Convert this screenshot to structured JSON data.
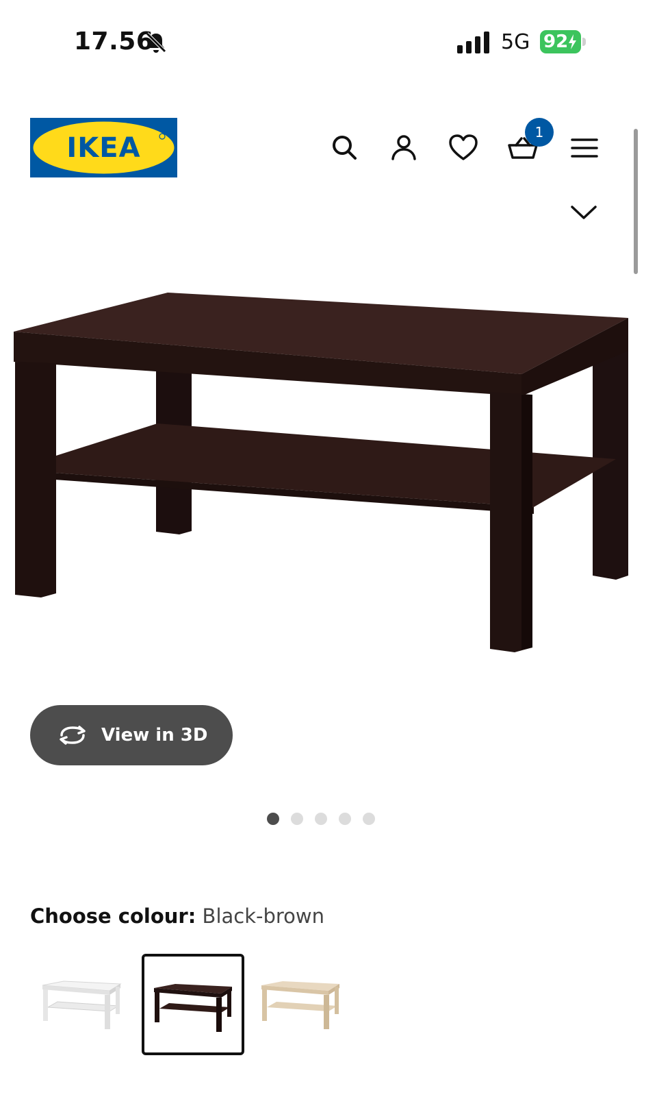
{
  "status_bar": {
    "time": "17.56",
    "network": "5G",
    "battery": "92"
  },
  "header": {
    "logo_text": "IKEA",
    "basket_count": "1",
    "colors": {
      "brand_blue": "#0058a3",
      "brand_yellow": "#ffda1a"
    }
  },
  "product": {
    "view_3d_label": "View in 3D",
    "carousel": {
      "count": 5,
      "active": 1
    }
  },
  "colour": {
    "label": "Choose colour:",
    "selected": "Black-brown",
    "options": [
      "white",
      "black-brown",
      "birch"
    ]
  }
}
